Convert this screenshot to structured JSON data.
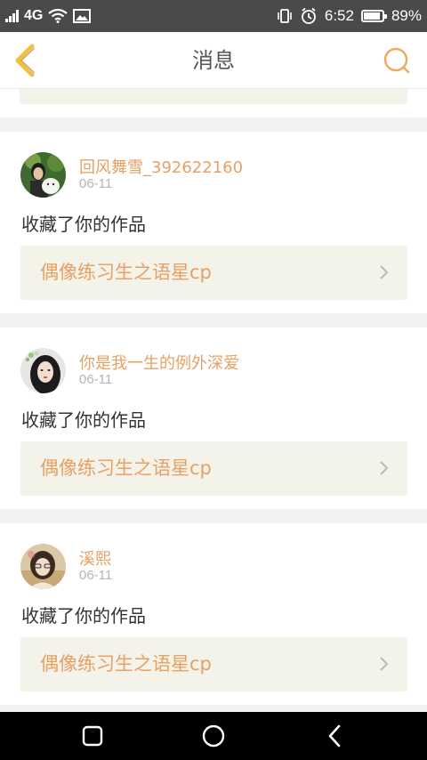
{
  "status_bar": {
    "network": "4G",
    "time": "6:52",
    "battery_percent": "89%",
    "battery_level": 0.89,
    "icons": [
      "signal-icon",
      "wifi-icon",
      "image-notification-icon",
      "vibrate-icon",
      "alarm-icon",
      "battery-icon"
    ]
  },
  "header": {
    "title": "消息",
    "back_icon": "chevron-left-icon",
    "search_icon": "search-icon"
  },
  "messages": [
    {
      "username": "回风舞雪_392622160",
      "date": "06-11",
      "action": "收藏了你的作品",
      "work_title": "偶像练习生之语星cp"
    },
    {
      "username": "你是我一生的例外深爱",
      "date": "06-11",
      "action": "收藏了你的作品",
      "work_title": "偶像练习生之语星cp"
    },
    {
      "username": "溪熙",
      "date": "06-11",
      "action": "收藏了你的作品",
      "work_title": "偶像练习生之语星cp"
    }
  ],
  "nav_bar": {
    "icons": [
      "recents-square-icon",
      "home-circle-icon",
      "back-triangle-icon"
    ]
  },
  "colors": {
    "accent": "#e8a063",
    "header_icon": "#f0c040",
    "link_bg": "#f3f3ea"
  }
}
